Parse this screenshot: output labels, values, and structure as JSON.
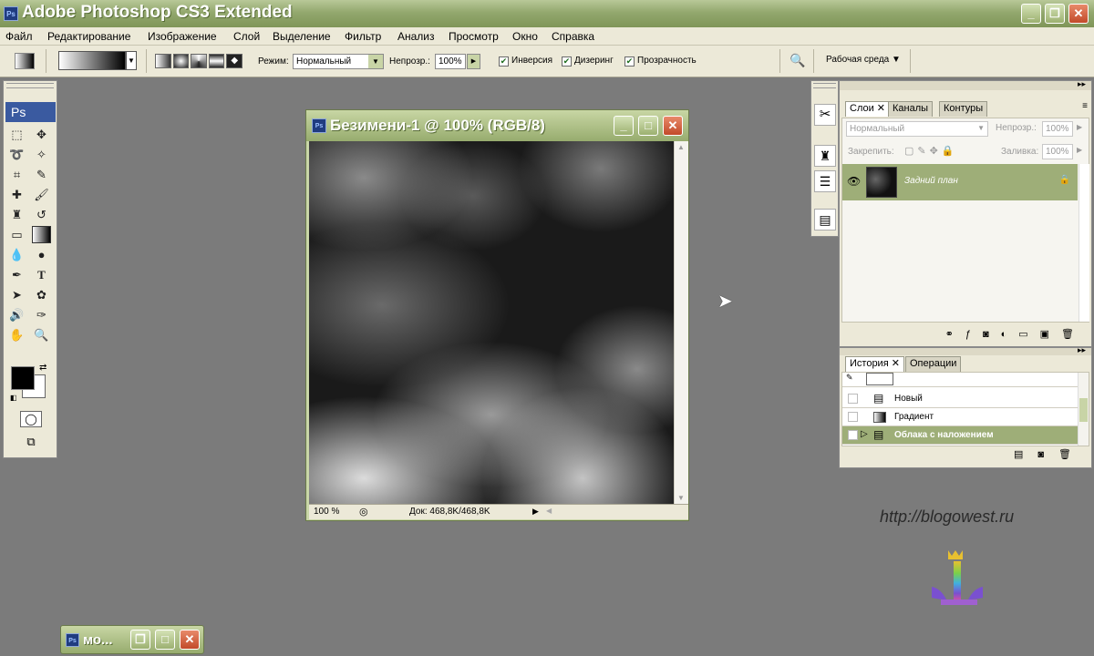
{
  "app": {
    "title": "Adobe Photoshop CS3 Extended",
    "logo": "Ps"
  },
  "menu": [
    "Файл",
    "Редактирование",
    "Изображение",
    "Слой",
    "Выделение",
    "Фильтр",
    "Анализ",
    "Просмотр",
    "Окно",
    "Справка"
  ],
  "options": {
    "mode_label": "Режим:",
    "mode_value": "Нормальный",
    "opacity_label": "Непрозр.:",
    "opacity_value": "100%",
    "reverse_label": "Инверсия",
    "dither_label": "Дизеринг",
    "transparency_label": "Прозрачность",
    "workspace_label": "Рабочая среда ▼"
  },
  "toolbox": {
    "logo": "Ps"
  },
  "document": {
    "title": "Безимени-1 @ 100% (RGB/8)",
    "zoom": "100 %",
    "doc_info": "Док: 468,8K/468,8K"
  },
  "layers": {
    "tabs": [
      "Слои",
      "Каналы",
      "Контуры"
    ],
    "blend_mode": "Нормальный",
    "opacity_label": "Непрозр.:",
    "opacity_value": "100%",
    "lock_label": "Закрепить:",
    "fill_label": "Заливка:",
    "fill_value": "100%",
    "layer_name": "Задний план"
  },
  "history": {
    "tabs": [
      "История",
      "Операции"
    ],
    "items": [
      "Новый",
      "Градиент",
      "Облака с наложением"
    ]
  },
  "taskbar": {
    "label": "мо..."
  },
  "watermark": {
    "url": "http://blogowest.ru"
  },
  "colors": {
    "titlebar": "#93a86e",
    "selected": "#9eae78"
  }
}
